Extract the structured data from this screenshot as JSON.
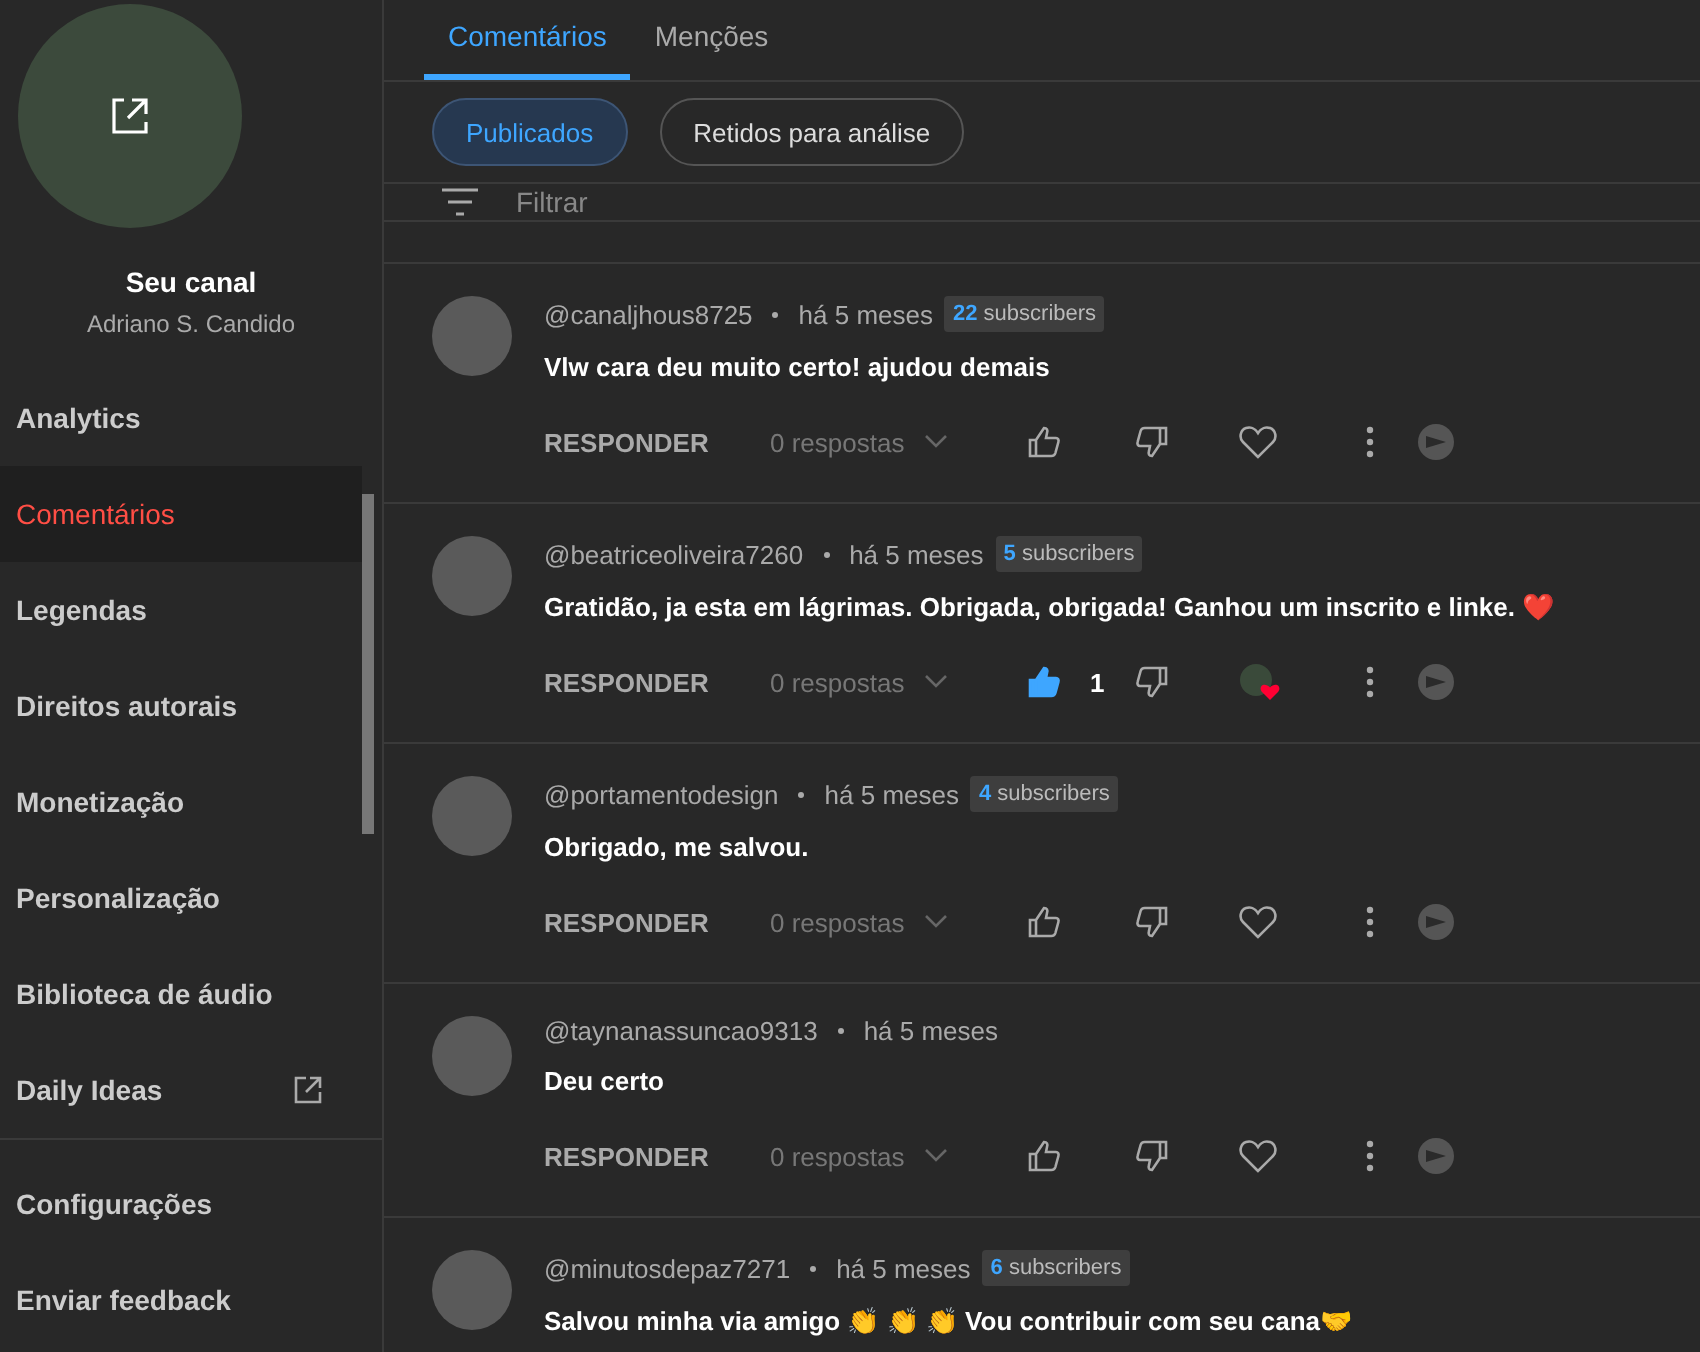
{
  "sidebar": {
    "title": "Seu canal",
    "channel_name": "Adriano S. Candido",
    "items": [
      {
        "label": "Analytics",
        "selected": false,
        "external": false
      },
      {
        "label": "Comentários",
        "selected": true,
        "external": false
      },
      {
        "label": "Legendas",
        "selected": false,
        "external": false
      },
      {
        "label": "Direitos autorais",
        "selected": false,
        "external": false
      },
      {
        "label": "Monetização",
        "selected": false,
        "external": false
      },
      {
        "label": "Personalização",
        "selected": false,
        "external": false
      },
      {
        "label": "Biblioteca de áudio",
        "selected": false,
        "external": false
      },
      {
        "label": "Daily Ideas",
        "selected": false,
        "external": true
      }
    ],
    "footer_items": [
      "Configurações",
      "Enviar feedback"
    ]
  },
  "tabs": [
    {
      "label": "Comentários",
      "selected": true
    },
    {
      "label": "Menções",
      "selected": false
    }
  ],
  "chips": [
    {
      "label": "Publicados",
      "selected": true
    },
    {
      "label": "Retidos para análise",
      "selected": false
    }
  ],
  "filter": {
    "placeholder": "Filtrar"
  },
  "comments": [
    {
      "author": "@canaljhous8725",
      "time": "há 5 meses",
      "badge": {
        "count": "22",
        "label": "subscribers"
      },
      "text": "Vlw cara deu muito certo! ajudou demais",
      "reply_label": "RESPONDER",
      "replies": "0 respostas",
      "liked": false,
      "creator_heart": false
    },
    {
      "author": "@beatriceoliveira7260",
      "time": "há 5 meses",
      "badge": {
        "count": "5",
        "label": "subscribers"
      },
      "text": "Gratidão, ja esta em lágrimas. Obrigada, obrigada! Ganhou um inscrito e linke. ❤️",
      "reply_label": "RESPONDER",
      "replies": "0 respostas",
      "liked": true,
      "like_count": "1",
      "creator_heart": true
    },
    {
      "author": "@portamentodesign",
      "time": "há 5 meses",
      "badge": {
        "count": "4",
        "label": "subscribers"
      },
      "text": "Obrigado, me salvou.",
      "reply_label": "RESPONDER",
      "replies": "0 respostas",
      "liked": false,
      "creator_heart": false
    },
    {
      "author": "@taynanassuncao9313",
      "time": "há 5 meses",
      "text": "Deu certo",
      "reply_label": "RESPONDER",
      "replies": "0 respostas",
      "liked": false,
      "creator_heart": false
    },
    {
      "author": "@minutosdepaz7271",
      "time": "há 5 meses",
      "badge": {
        "count": "6",
        "label": "subscribers"
      },
      "text": "Salvou minha via amigo 👏 👏 👏 Vou contribuir com seu cana🤝"
    }
  ]
}
